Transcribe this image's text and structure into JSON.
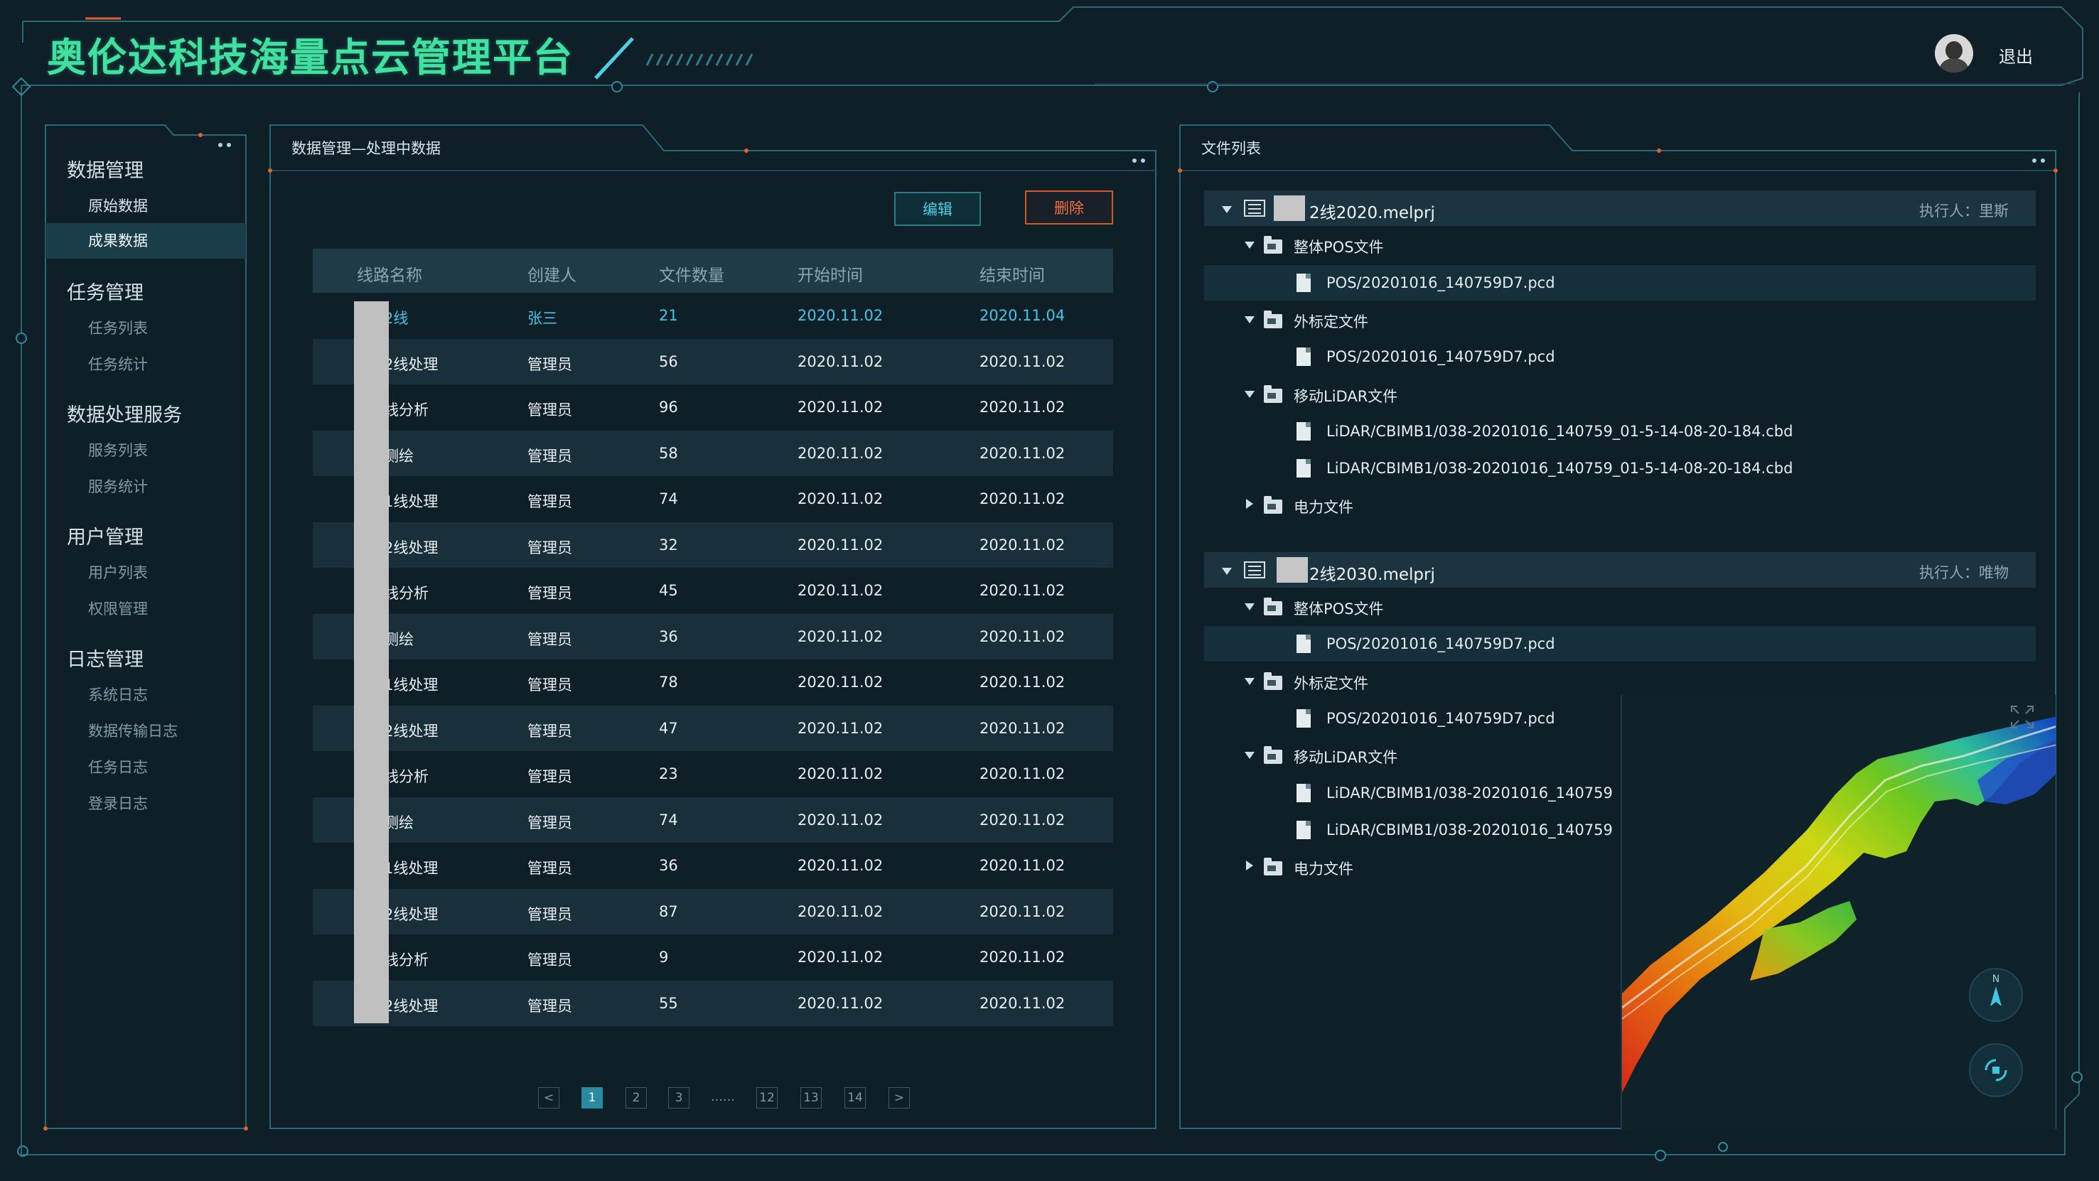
{
  "header": {
    "title": "奥伦达科技海量点云管理平台",
    "logout_label": "退出"
  },
  "sidebar": {
    "groups": [
      {
        "label": "数据管理",
        "items": [
          "原始数据",
          "成果数据"
        ]
      },
      {
        "label": "任务管理",
        "items": [
          "任务列表",
          "任务统计"
        ]
      },
      {
        "label": "数据处理服务",
        "items": [
          "服务列表",
          "服务统计"
        ]
      },
      {
        "label": "用户管理",
        "items": [
          "用户列表",
          "权限管理"
        ]
      },
      {
        "label": "日志管理",
        "items": [
          "系统日志",
          "数据传输日志",
          "任务日志",
          "登录日志"
        ]
      }
    ],
    "active_item": "成果数据"
  },
  "main": {
    "panel_title": "数据管理—处理中数据",
    "edit_label": "编辑",
    "delete_label": "删除",
    "columns": [
      "线路名称",
      "创建人",
      "文件数量",
      "开始时间",
      "结束时间"
    ],
    "rows": [
      [
        "2线",
        "张三",
        "21",
        "2020.11.02",
        "2020.11.04"
      ],
      [
        "2线处理",
        "管理员",
        "56",
        "2020.11.02",
        "2020.11.02"
      ],
      [
        "线分析",
        "管理员",
        "96",
        "2020.11.02",
        "2020.11.02"
      ],
      [
        "测绘",
        "管理员",
        "58",
        "2020.11.02",
        "2020.11.02"
      ],
      [
        "1线处理",
        "管理员",
        "74",
        "2020.11.02",
        "2020.11.02"
      ],
      [
        "2线处理",
        "管理员",
        "32",
        "2020.11.02",
        "2020.11.02"
      ],
      [
        "线分析",
        "管理员",
        "45",
        "2020.11.02",
        "2020.11.02"
      ],
      [
        "测绘",
        "管理员",
        "36",
        "2020.11.02",
        "2020.11.02"
      ],
      [
        "1线处理",
        "管理员",
        "78",
        "2020.11.02",
        "2020.11.02"
      ],
      [
        "2线处理",
        "管理员",
        "47",
        "2020.11.02",
        "2020.11.02"
      ],
      [
        "线分析",
        "管理员",
        "23",
        "2020.11.02",
        "2020.11.02"
      ],
      [
        "测绘",
        "管理员",
        "74",
        "2020.11.02",
        "2020.11.02"
      ],
      [
        "1线处理",
        "管理员",
        "36",
        "2020.11.02",
        "2020.11.02"
      ],
      [
        "2线处理",
        "管理员",
        "87",
        "2020.11.02",
        "2020.11.02"
      ],
      [
        "线分析",
        "管理员",
        "9",
        "2020.11.02",
        "2020.11.02"
      ],
      [
        "2线处理",
        "管理员",
        "55",
        "2020.11.02",
        "2020.11.02"
      ]
    ],
    "pagination": [
      "<",
      "1",
      "2",
      "3",
      "……",
      "12",
      "13",
      "14",
      ">"
    ],
    "current_page": "1"
  },
  "files": {
    "panel_title": "文件列表",
    "projects": [
      {
        "name": "2线2020.melprj",
        "executor": "执行人：里斯",
        "folders": [
          {
            "name": "整体POS文件",
            "expanded": true,
            "files": [
              "POS/20201016_140759D7.pcd"
            ]
          },
          {
            "name": "外标定文件",
            "expanded": true,
            "files": [
              "POS/20201016_140759D7.pcd"
            ]
          },
          {
            "name": "移动LiDAR文件",
            "expanded": true,
            "files": [
              "LiDAR/CBIMB1/038-20201016_140759_01-5-14-08-20-184.cbd",
              "LiDAR/CBIMB1/038-20201016_140759_01-5-14-08-20-184.cbd"
            ]
          },
          {
            "name": "电力文件",
            "expanded": false,
            "files": []
          }
        ]
      },
      {
        "name": "2线2030.melprj",
        "executor": "执行人：唯物",
        "folders": [
          {
            "name": "整体POS文件",
            "expanded": true,
            "files": [
              "POS/20201016_140759D7.pcd"
            ]
          },
          {
            "name": "外标定文件",
            "expanded": true,
            "files": [
              "POS/20201016_140759D7.pcd"
            ]
          },
          {
            "name": "移动LiDAR文件",
            "expanded": true,
            "files": [
              "LiDAR/CBIMB1/038-20201016_140759",
              "LiDAR/CBIMB1/038-20201016_140759"
            ]
          },
          {
            "name": "电力文件",
            "expanded": false,
            "files": []
          }
        ]
      }
    ]
  },
  "viewer": {
    "compass_label": "N"
  },
  "colors": {
    "background": "#0f1f28",
    "accent": "#3fc6e6",
    "title": "#3fe0a0",
    "danger": "#f07040",
    "frame": "#2a6878"
  }
}
